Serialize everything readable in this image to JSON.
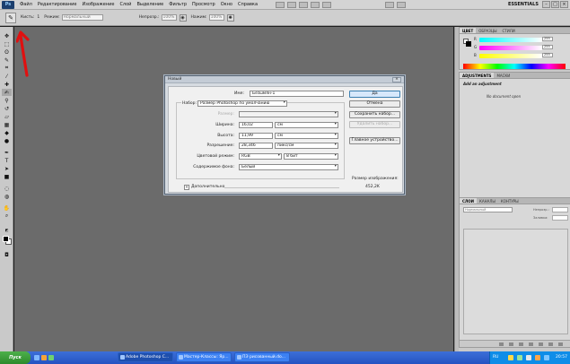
{
  "menubar": {
    "logo": "Ps",
    "items": [
      "Файл",
      "Редактирование",
      "Изображение",
      "Слой",
      "Выделение",
      "Фильтр",
      "Просмотр",
      "Окно",
      "Справка"
    ],
    "workspace": "ESSENTIALS"
  },
  "options_bar": {
    "brush_label": "Кисть:",
    "brush_size": "1",
    "mode_label": "Режим:",
    "mode_value": "Нормальный",
    "opacity_label": "Непрозр.:",
    "opacity_value": "100%",
    "flow_label": "Нажим:",
    "flow_value": "100%"
  },
  "dialog": {
    "title": "Новый",
    "name_label": "Имя:",
    "name_value": "Безымян-1",
    "preset_label": "Набор:",
    "preset_value": "Размер Photoshop по умолчанию",
    "size_label": "Размер:",
    "width_label": "Ширина:",
    "width_value": "16,02",
    "width_unit": "см",
    "height_label": "Высота:",
    "height_value": "11,99",
    "height_unit": "см",
    "resolution_label": "Разрешение:",
    "resolution_value": "28,346",
    "resolution_unit": "пикс/см",
    "colormode_label": "Цветовой режим:",
    "colormode_value": "RGB",
    "bitdepth_value": "8 бит",
    "background_label": "Содержимое фона:",
    "background_value": "Белый",
    "advanced_label": "Дополнительно",
    "advanced_toggle": "»",
    "ok_label": "Да",
    "cancel_label": "Отмена",
    "save_preset_label": "Сохранить набор...",
    "delete_preset_label": "Удалить набор...",
    "device_central_label": "Главное устройство...",
    "image_size_label": "Размер изображения:",
    "image_size_value": "452,2K"
  },
  "color_panel": {
    "tabs": [
      "ЦВЕТ",
      "ОБРАЗЦЫ",
      "СТИЛИ"
    ],
    "r_label": "R",
    "r_value": "255",
    "g_label": "G",
    "g_value": "255",
    "b_label": "B",
    "b_value": "255"
  },
  "adjustments_panel": {
    "tabs": [
      "ADJUSTMENTS",
      "МАСКИ"
    ],
    "title": "Add an adjustment",
    "message": "No document open"
  },
  "layers_panel": {
    "tabs": [
      "СЛОИ",
      "КАНАЛЫ",
      "КОНТУРЫ"
    ],
    "blend_mode": "Нормальный",
    "opacity_label": "Непрозр.:",
    "fill_label": "Заливка:"
  },
  "taskbar": {
    "start_label": "Пуск",
    "tasks": [
      "Adobe Photoshop C...",
      "Мастер-Классы: Яр...",
      "ПЭ рисованный.do..."
    ],
    "lang": "RU",
    "clock": "20:57"
  },
  "colors": {
    "workspace": "#6b6b6b",
    "annotation": "#e01010"
  }
}
